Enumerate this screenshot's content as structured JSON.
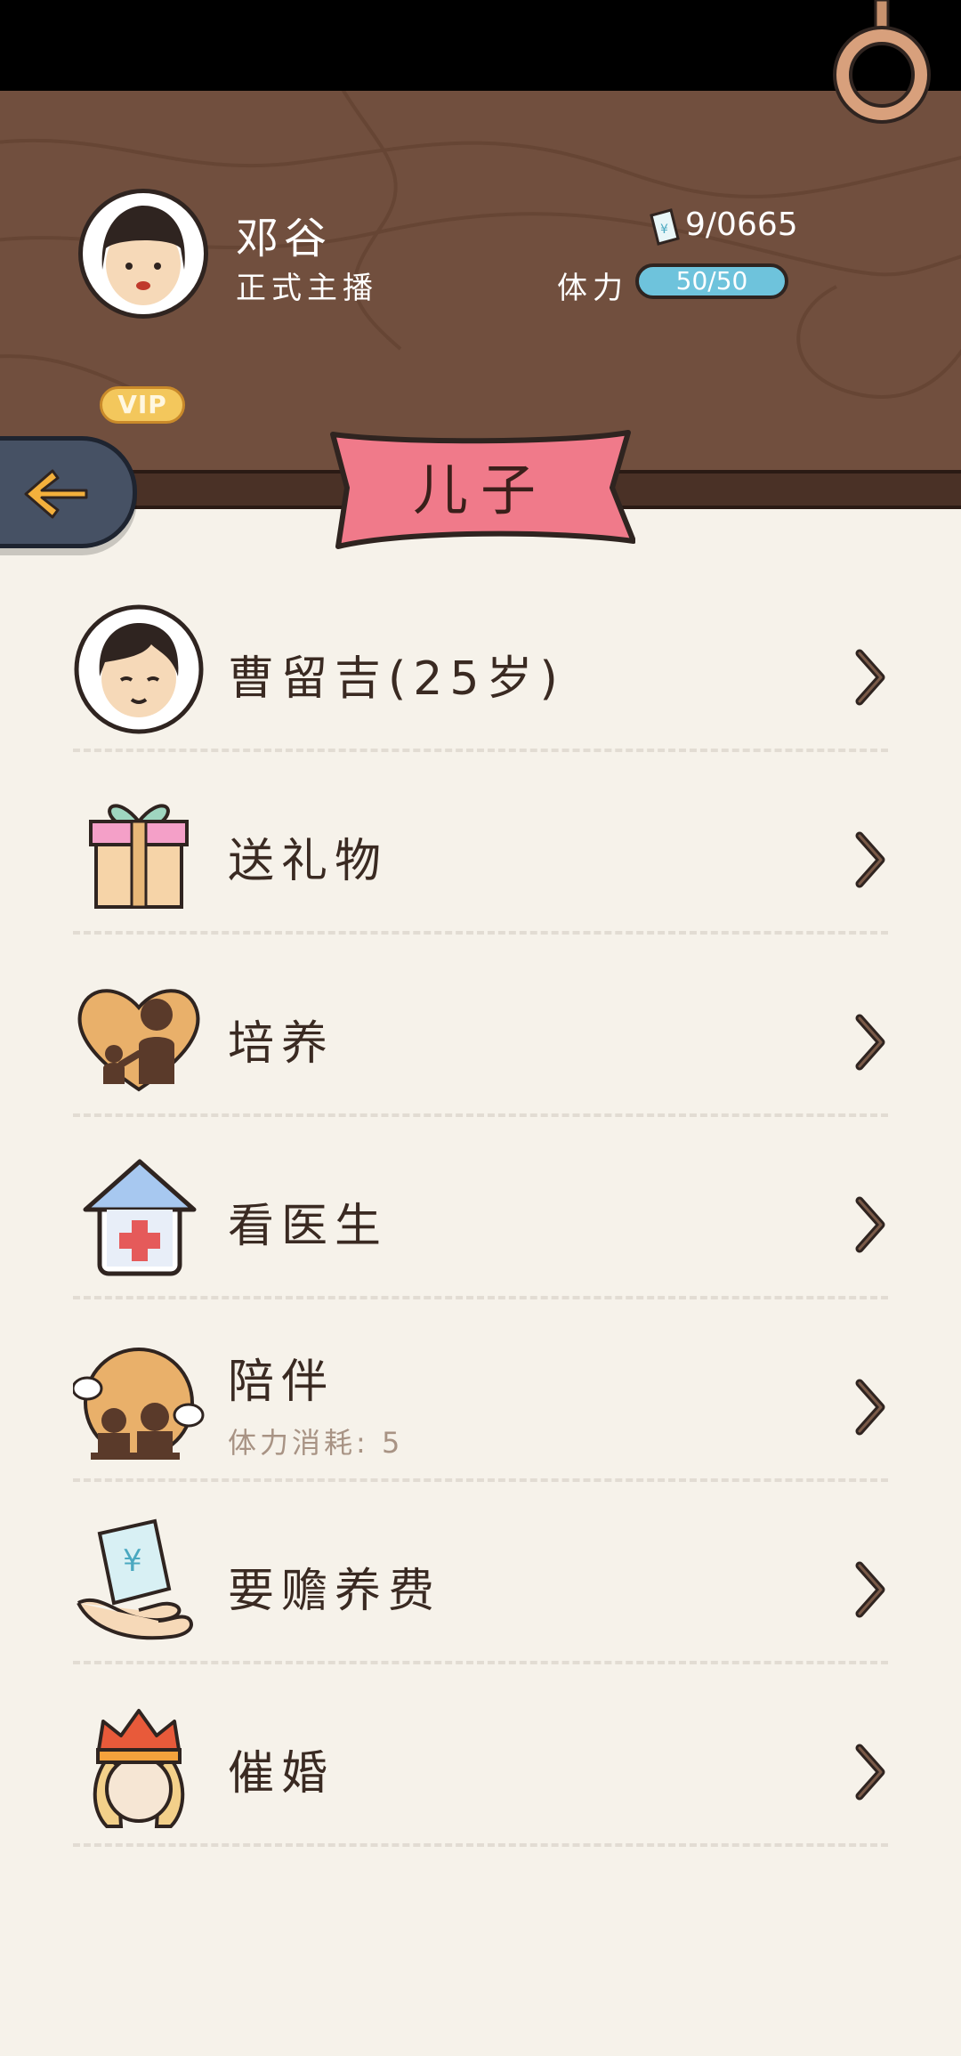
{
  "header": {
    "username": "邓谷",
    "user_title": "正式主播",
    "vip_label": "VIP",
    "money": "9/0665",
    "stamina_label": "体力",
    "stamina_value": "50/50",
    "back_icon": "back-arrow-icon",
    "ring_icon": "hanging-ring-icon"
  },
  "page": {
    "title": "儿子"
  },
  "menu": {
    "items": [
      {
        "label": "曹留吉(25岁)",
        "icon": "son-avatar-icon"
      },
      {
        "label": "送礼物",
        "icon": "gift-icon"
      },
      {
        "label": "培养",
        "icon": "nurture-icon"
      },
      {
        "label": "看医生",
        "icon": "hospital-icon"
      },
      {
        "label": "陪伴",
        "sub": "体力消耗: 5",
        "icon": "companionship-icon"
      },
      {
        "label": "要赡养费",
        "icon": "allowance-money-icon"
      },
      {
        "label": "催婚",
        "icon": "urge-marriage-icon"
      }
    ]
  },
  "colors": {
    "header_bg": "#714f3e",
    "page_bg": "#f6f2ea",
    "ribbon": "#f07a8a",
    "stamina": "#6ec3dc",
    "back_button": "#465164",
    "vip": "#f3c75c"
  }
}
